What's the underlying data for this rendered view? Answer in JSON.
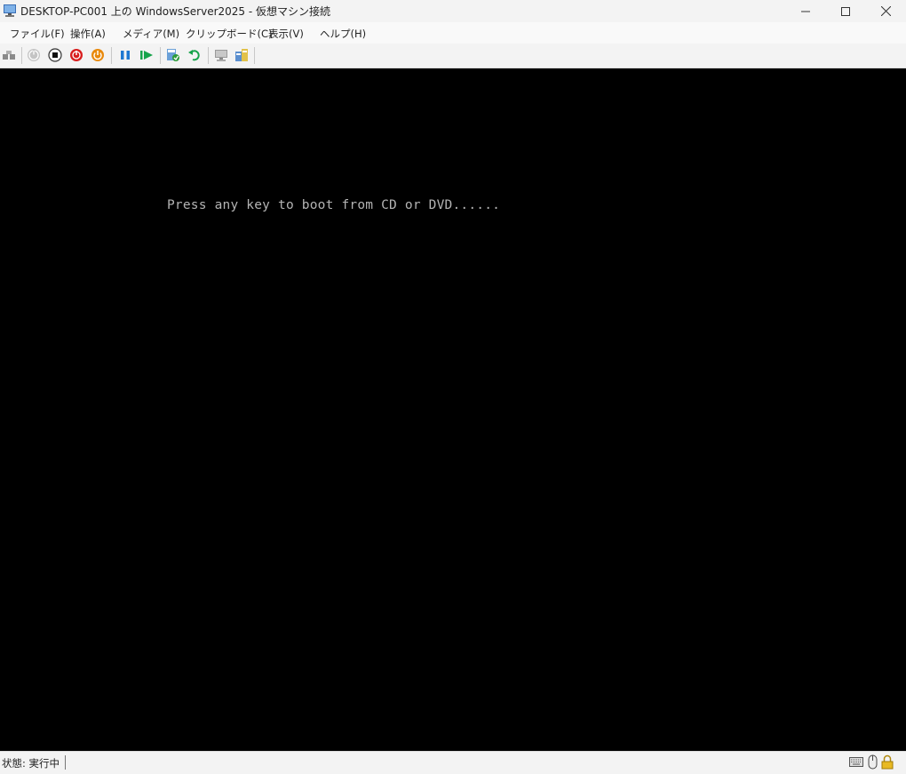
{
  "window": {
    "title": "DESKTOP-PC001 上の WindowsServer2025  - 仮想マシン接続",
    "controls": [
      "minimize",
      "maximize",
      "close"
    ]
  },
  "menu": {
    "file": "ファイル(F)",
    "action": "操作(A)",
    "media": "メディア(M)",
    "clipboard": "クリップボード(C)",
    "view": "表示(V)",
    "help": "ヘルプ(H)"
  },
  "toolbar": {
    "icons": [
      "ctrl-alt-del-icon",
      "start-icon",
      "turn-off-icon",
      "shut-down-icon",
      "power-button-icon",
      "pause-icon",
      "resume-icon",
      "checkpoint-icon",
      "revert-icon",
      "enhanced-session-icon",
      "share-icon"
    ],
    "colors": {
      "shutdown_red": "#d81e1e",
      "save_orange": "#e8890c",
      "pause_blue": "#1e78d2",
      "resume_green": "#16a34a"
    }
  },
  "screen": {
    "console_text": "Press any key to boot from CD or DVD......",
    "background": "#000000",
    "text_color": "#b4b4b4"
  },
  "status": {
    "label": "状態: 実行中",
    "icons": [
      "keyboard-icon",
      "mouse-icon",
      "lock-icon"
    ]
  }
}
